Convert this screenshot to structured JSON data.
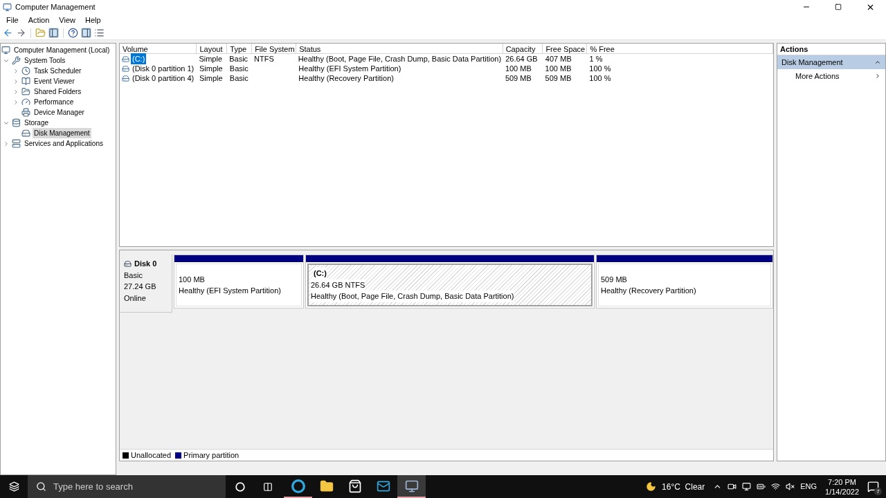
{
  "window": {
    "title": "Computer Management"
  },
  "menu": [
    "File",
    "Action",
    "View",
    "Help"
  ],
  "tree": [
    {
      "label": "Computer Management (Local)",
      "selected": false,
      "children": [
        {
          "label": "System Tools",
          "expanded": true,
          "selected": false,
          "children": [
            {
              "label": "Task Scheduler",
              "expanded": false,
              "selected": false
            },
            {
              "label": "Event Viewer",
              "expanded": false,
              "selected": false
            },
            {
              "label": "Shared Folders",
              "expanded": false,
              "selected": false
            },
            {
              "label": "Performance",
              "expanded": false,
              "selected": false
            },
            {
              "label": "Device Manager",
              "selected": false
            }
          ]
        },
        {
          "label": "Storage",
          "expanded": true,
          "selected": false,
          "children": [
            {
              "label": "Disk Management",
              "selected": true
            }
          ]
        },
        {
          "label": "Services and Applications",
          "expanded": false,
          "selected": false
        }
      ]
    }
  ],
  "volumes": {
    "columns": [
      "Volume",
      "Layout",
      "Type",
      "File System",
      "Status",
      "Capacity",
      "Free Space",
      "% Free"
    ],
    "rows": [
      {
        "selected": true,
        "cells": [
          "(C:)",
          "Simple",
          "Basic",
          "NTFS",
          "Healthy (Boot, Page File, Crash Dump, Basic Data Partition)",
          "26.64 GB",
          "407 MB",
          "1 %"
        ]
      },
      {
        "selected": false,
        "cells": [
          "(Disk 0 partition 1)",
          "Simple",
          "Basic",
          "",
          "Healthy (EFI System Partition)",
          "100 MB",
          "100 MB",
          "100 %"
        ]
      },
      {
        "selected": false,
        "cells": [
          "(Disk 0 partition 4)",
          "Simple",
          "Basic",
          "",
          "Healthy (Recovery Partition)",
          "509 MB",
          "509 MB",
          "100 %"
        ]
      }
    ]
  },
  "disk": {
    "name": "Disk 0",
    "type": "Basic",
    "size": "27.24 GB",
    "state": "Online",
    "partitions": [
      {
        "selected": false,
        "size": "100 MB",
        "status": "Healthy (EFI System Partition)"
      },
      {
        "selected": true,
        "label": "(C:)",
        "size": "26.64 GB NTFS",
        "status": "Healthy (Boot, Page File, Crash Dump, Basic Data Partition)"
      },
      {
        "selected": false,
        "size": "509 MB",
        "status": "Healthy (Recovery Partition)"
      }
    ]
  },
  "legend": [
    {
      "label": "Unallocated",
      "color": "#000000"
    },
    {
      "label": "Primary partition",
      "color": "#000080"
    }
  ],
  "actions": {
    "title": "Actions",
    "section": "Disk Management",
    "items": [
      "More Actions"
    ]
  },
  "taskbar": {
    "search_placeholder": "Type here to search",
    "apps": [
      {
        "running": true,
        "selected": false
      },
      {
        "running": false,
        "selected": false
      },
      {
        "running": false,
        "selected": false
      },
      {
        "running": false,
        "selected": false
      },
      {
        "running": true,
        "selected": true
      }
    ],
    "weather": "16°C  Clear",
    "language": "ENG",
    "time": "7:20 PM",
    "date": "1/14/2022",
    "notifications": "7"
  }
}
